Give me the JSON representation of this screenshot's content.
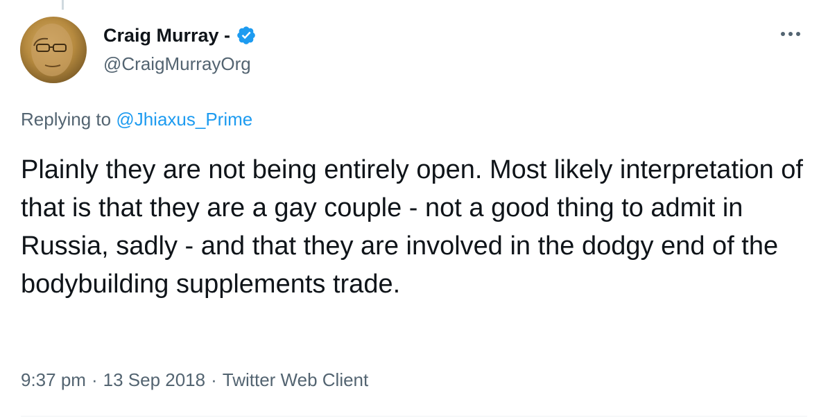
{
  "author": {
    "display_name": "Craig Murray -",
    "handle": "@CraigMurrayOrg",
    "verified": true
  },
  "reply": {
    "prefix": "Replying to",
    "mention": "@Jhiaxus_Prime"
  },
  "tweet": {
    "text": "Plainly they are not being entirely open. Most likely interpretation of that is that they are a gay couple - not a good thing to admit in Russia, sadly - and that they are involved in the dodgy end of the bodybuilding supplements trade."
  },
  "meta": {
    "time": "9:37 pm",
    "date": "13 Sep 2018",
    "client": "Twitter Web Client",
    "separator": "·"
  },
  "colors": {
    "accent": "#1d9bf0",
    "secondary_text": "#536471",
    "primary_text": "#0f1419"
  },
  "icons": {
    "verified": "verified-badge-icon",
    "more": "more-options-icon"
  }
}
